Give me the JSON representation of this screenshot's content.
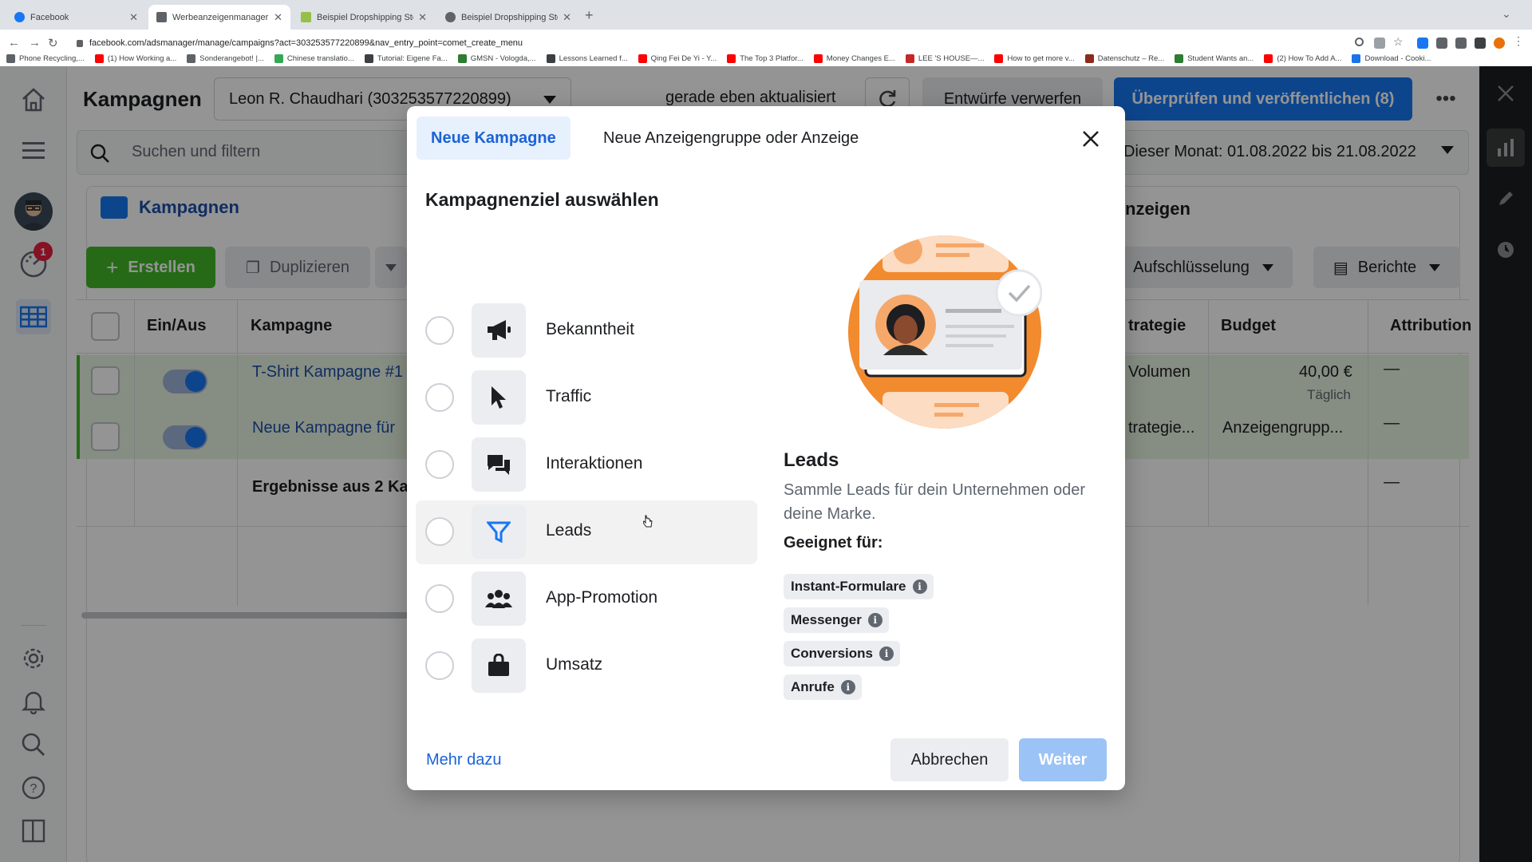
{
  "browser": {
    "tabs": [
      {
        "title": "Facebook",
        "color": "#1877f2"
      },
      {
        "title": "Werbeanzeigenmanager - Wer",
        "color": "#5f6368"
      },
      {
        "title": "Beispiel Dropshipping Store - T",
        "color": "#95bf47"
      },
      {
        "title": "Beispiel Dropshipping Store",
        "color": "#5f6368"
      }
    ],
    "url": "facebook.com/adsmanager/manage/campaigns?act=303253577220899&nav_entry_point=comet_create_menu",
    "bookmarks": [
      "Phone Recycling,...",
      "(1) How Working a...",
      "Sonderangebot! |...",
      "Chinese translatio...",
      "Tutorial: Eigene Fa...",
      "GMSN - Vologda,...",
      "Lessons Learned f...",
      "Qing Fei De Yi - Y...",
      "The Top 3 Platfor...",
      "Money Changes E...",
      "LEE 'S HOUSE—...",
      "How to get more v...",
      "Datenschutz – Re...",
      "Student Wants an...",
      "(2) How To Add A...",
      "Download - Cooki..."
    ]
  },
  "header": {
    "title": "Kampagnen",
    "account": "Leon R. Chaudhari (303253577220899)",
    "updated": "gerade eben aktualisiert",
    "discard": "Entwürfe verwerfen",
    "publish": "Überprüfen und veröffentlichen (8)"
  },
  "leftnav": {
    "notification_count": "1"
  },
  "search": {
    "placeholder": "Suchen und filtern",
    "daterange": "Dieser Monat: 01.08.2022 bis 21.08.2022"
  },
  "panel": {
    "tab_campaigns": "Kampagnen",
    "tab_ads": "nzeigen",
    "create": "Erstellen",
    "duplicate": "Duplizieren",
    "breakdown": "Aufschlüsselung",
    "reports": "Berichte"
  },
  "table": {
    "headers": [
      "Ein/Aus",
      "Kampagne",
      "trategie",
      "Budget",
      "Attribution"
    ],
    "rows": [
      {
        "name": "T-Shirt Kampagne #1",
        "strategy": "Volumen",
        "budget": "40,00 €",
        "budget_sub": "Täglich",
        "attribution": "—"
      },
      {
        "name": "Neue Kampagne für",
        "strategy": "trategie...",
        "budget": "Anzeigengrupp...",
        "budget_sub": "",
        "attribution": "—"
      }
    ],
    "summary": "Ergebnisse aus 2 Ka",
    "summary_attribution": "—"
  },
  "modal": {
    "tab_campaign": "Neue Kampagne",
    "tab_adset": "Neue Anzeigengruppe oder Anzeige",
    "heading": "Kampagnenziel auswählen",
    "objectives": [
      {
        "label": "Bekanntheit",
        "icon": "megaphone-icon"
      },
      {
        "label": "Traffic",
        "icon": "cursor-icon"
      },
      {
        "label": "Interaktionen",
        "icon": "chat-bubbles-icon"
      },
      {
        "label": "Leads",
        "icon": "funnel-icon",
        "selected": true
      },
      {
        "label": "App-Promotion",
        "icon": "people-icon"
      },
      {
        "label": "Umsatz",
        "icon": "shopping-bag-icon"
      }
    ],
    "detail": {
      "title": "Leads",
      "description": "Sammle Leads für dein Unternehmen oder deine Marke.",
      "suited_for_label": "Geeignet für:",
      "chips": [
        "Instant-Formulare",
        "Messenger",
        "Conversions",
        "Anrufe"
      ]
    },
    "learn_more": "Mehr dazu",
    "cancel": "Abbrechen",
    "next": "Weiter"
  },
  "colors": {
    "accent": "#1877f2",
    "create_green": "#42b72a",
    "illustration_orange": "#f28a2e"
  }
}
